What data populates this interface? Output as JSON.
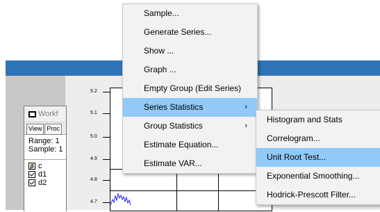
{
  "main_menu": {
    "items": [
      {
        "label": "Sample...",
        "submenu": false
      },
      {
        "label": "Generate Series...",
        "submenu": false
      },
      {
        "label": "Show ...",
        "submenu": false
      },
      {
        "label": "Graph ...",
        "submenu": false
      },
      {
        "label": "Empty Group (Edit Series)",
        "submenu": false
      },
      {
        "label": "Series Statistics",
        "submenu": true,
        "active": true
      },
      {
        "label": "Group Statistics",
        "submenu": true
      },
      {
        "label": "Estimate Equation...",
        "submenu": false
      },
      {
        "label": "Estimate VAR...",
        "submenu": false
      }
    ],
    "arrow_glyph": "›"
  },
  "sub_menu": {
    "items": [
      {
        "label": "Histogram and Stats"
      },
      {
        "label": "Correlogram..."
      },
      {
        "label": "Unit Root Test...",
        "active": true
      },
      {
        "label": "Exponential Smoothing..."
      },
      {
        "label": "Hodrick-Prescott Filter..."
      }
    ]
  },
  "workfile": {
    "title": "Workf",
    "toolbar": [
      "View",
      "Proc"
    ],
    "range_label": "Range:",
    "range_value": "1",
    "sample_label": "Sample:",
    "sample_value": "1",
    "objects": [
      {
        "icon": "β",
        "name": "c"
      },
      {
        "icon": "check",
        "name": "d1"
      },
      {
        "icon": "check",
        "name": "d2"
      }
    ]
  },
  "graph": {
    "y_ticks": [
      "5.2",
      "5.1",
      "5.0",
      "4.9",
      "4.8",
      "4.7"
    ]
  },
  "colors": {
    "menu_highlight": "#91c9f7",
    "title_bar_blue": "#2f74b6",
    "series_line": "#1a1aff"
  }
}
